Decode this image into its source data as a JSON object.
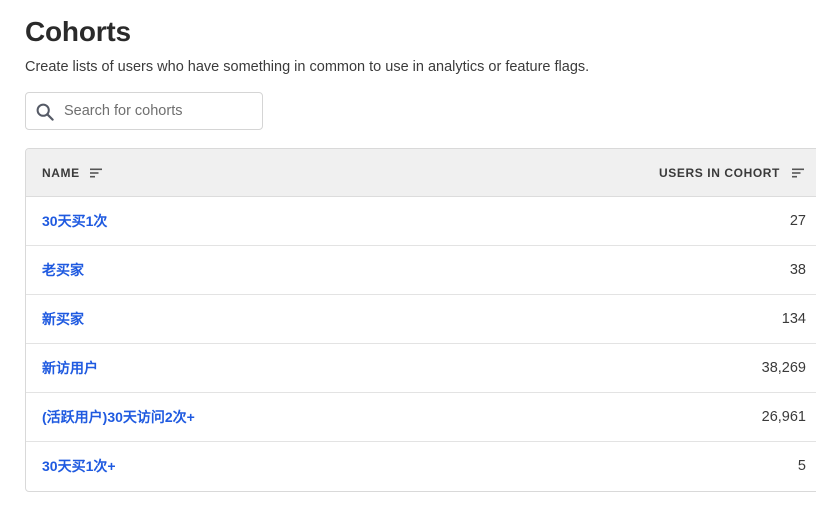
{
  "header": {
    "title": "Cohorts",
    "subtitle": "Create lists of users who have something in common to use in analytics or feature flags."
  },
  "search": {
    "placeholder": "Search for cohorts",
    "value": "",
    "icon": "search-icon"
  },
  "table": {
    "columns": [
      {
        "label": "NAME",
        "icon": "sort-icon"
      },
      {
        "label": "USERS IN COHORT",
        "icon": "sort-icon"
      }
    ],
    "rows": [
      {
        "name": "30天买1次",
        "count": "27"
      },
      {
        "name": "老买家",
        "count": "38"
      },
      {
        "name": "新买家",
        "count": "134"
      },
      {
        "name": "新访用户",
        "count": "38,269"
      },
      {
        "name": "(活跃用户)30天访问2次+",
        "count": "26,961"
      },
      {
        "name": "30天买1次+",
        "count": "5"
      }
    ]
  },
  "colors": {
    "link": "#1f5ae0",
    "header_bg": "#f0f0f0",
    "border": "#d9d9d9"
  }
}
